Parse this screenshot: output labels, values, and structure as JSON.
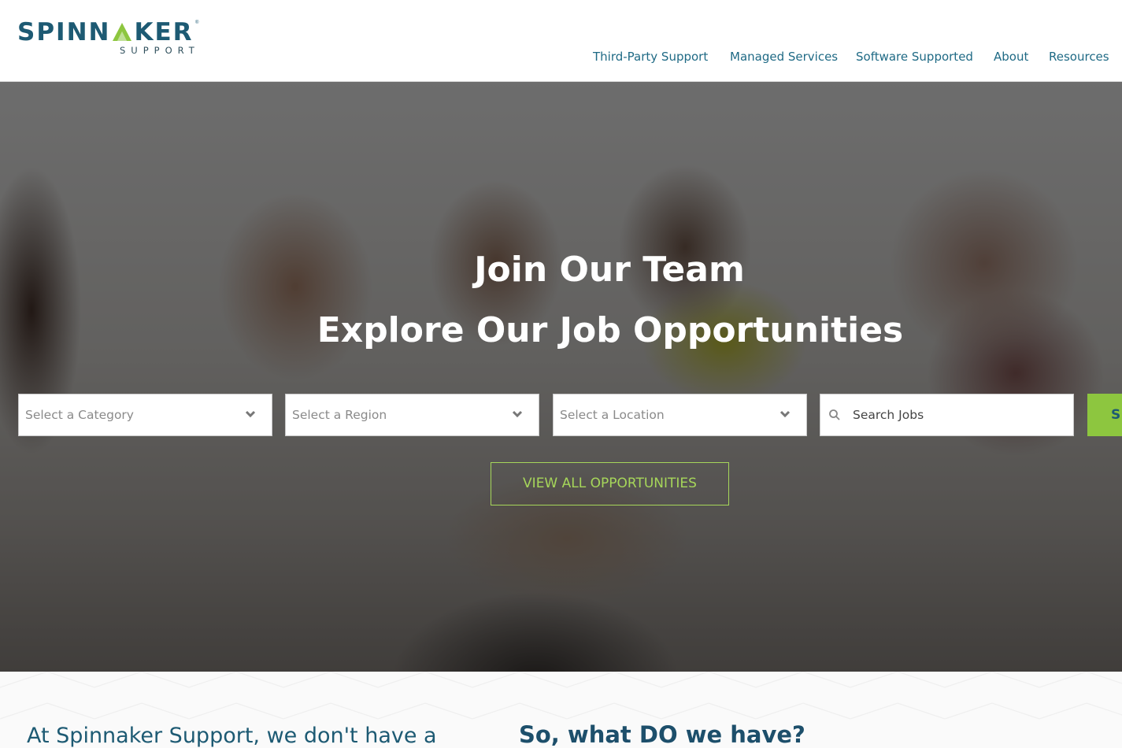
{
  "brand": {
    "name_part1": "SPINN",
    "name_part2": "KER",
    "sub": "SUPPORT",
    "trademark": "®",
    "accent_color": "#8dc63f",
    "primary_color": "#1d5a73"
  },
  "nav": {
    "items": [
      {
        "label": "Third-Party Support"
      },
      {
        "label": "Managed Services"
      },
      {
        "label": "Software Supported"
      },
      {
        "label": "About"
      },
      {
        "label": "Resources"
      }
    ]
  },
  "hero": {
    "title": "Join Our Team",
    "subtitle": "Explore Our Job Opportunities",
    "filters": {
      "category": {
        "selected": "Select a Category",
        "icon": "chevron-down-icon"
      },
      "region": {
        "selected": "Select a Region",
        "icon": "chevron-down-icon"
      },
      "location": {
        "selected": "Select a Location",
        "icon": "chevron-down-icon"
      },
      "search": {
        "placeholder": "Search Jobs",
        "icon": "search-icon"
      }
    },
    "search_button_label": "S",
    "view_all_label": "VIEW ALL OPPORTUNITIES"
  },
  "intro": {
    "left_text": "At Spinnaker Support, we don't have a",
    "right_heading": "So, what DO we have?"
  }
}
